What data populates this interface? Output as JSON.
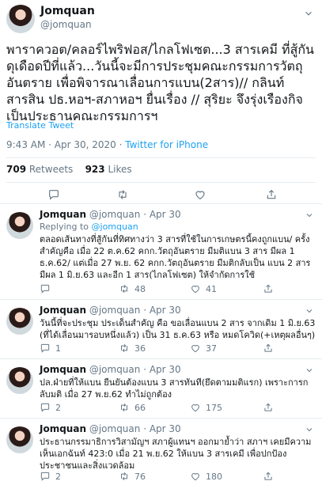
{
  "main_tweet": {
    "name": "Jomquan",
    "handle": "@jomquan",
    "text": "พาราควอต/คลอร์ไพริฟอส/ไกลโฟเซต...3 สารเคมี ที่สู้กันดุเดือดปีที่แล้ว...วันนี้จะมีการประชุมคณะกรรมการวัตถุอันตราย เพื่อพิจารณาเลื่อนการแบน(2สาร)// กลินท์ สารสิน ปธ.หอฯ-สภาหอฯ ยื่นเรื่อง // สุริยะ จึงรุ่งเรืองกิจ เป็นประธานคณะกรรมการฯ",
    "translate": "Translate Tweet",
    "time": "9:43 AM · Apr 30, 2020 · ",
    "source": "Twitter for iPhone",
    "retweets_count": "709",
    "retweets_label": " Retweets",
    "likes_count": "923",
    "likes_label": " Likes"
  },
  "replies": [
    {
      "name": "Jomquan",
      "handle": "@jomquan",
      "date": "· Apr 30",
      "replying_prefix": "Replying to ",
      "replying_handle": "@jomquan",
      "text": "ตลอดเส้นทางที่สู้กันที่ทิศทางว่า 3 สารที่ใช้ในการเกษตรนี้คงถูกแบน/ ครั้งสำคัญคือ เมื่อ 22 ต.ค.62 คกก.วัตถุอันตราย มีมติแบน 3 สาร มีผล 1 ธ.ค.62/ แต่เมื่อ 27 พ.ย. 62 คกก.วัตถุอันตราย มีมติกลับเป็น แบน 2 สาร มีผล 1 มิ.ย.63 และอีก 1 สาร(ไกลโฟเซต) ให้จำกัดการใช้",
      "replies": "",
      "retweets": "48",
      "likes": "41"
    },
    {
      "name": "Jomquan",
      "handle": "@jomquan",
      "date": "· Apr 30",
      "text": "วันนี้ที่จะประชุม ประเด็นสำคัญ คือ ขอเลื่อนแบน 2 สาร จากเดิม 1 มิ.ย.63 (ที่ได้เลื่อนมารอบหนึ่งแล้ว) เป็น 31 ธ.ค.63 หรือ หมดโควิด(+เหตุผลอื่นๆ)",
      "replies": "1",
      "retweets": "36",
      "likes": "37"
    },
    {
      "name": "Jomquan",
      "handle": "@jomquan",
      "date": "· Apr 30",
      "text": "ปล.ฝ่ายที่ให้แบน ยืนยันต้องแบน 3 สารทันที(ยึดตามมติแรก) เพราะการกลับมติ เมื่อ 27 พ.ย.62 ทำไม่ถูกต้อง",
      "replies": "2",
      "retweets": "66",
      "likes": "175"
    },
    {
      "name": "Jomquan",
      "handle": "@jomquan",
      "date": "· Apr 30",
      "text": "ประธานกรรมาธิการวิสามัญฯ สภาผู้แทนฯ ออกมาย้ำว่า สภาฯ เคยมีความเห็นเอกฉันท์ 423:0 เมื่อ 21 พ.ย.62 ให้แบน 3 สารเคมี เพื่อปกป้องประชาชนและสิ่งแวดล้อม",
      "replies": "2",
      "retweets": "76",
      "likes": "180"
    }
  ],
  "icons": {
    "reply": "reply-icon",
    "retweet": "retweet-icon",
    "like": "heart-icon",
    "share": "share-icon",
    "more": "chevron-down-icon"
  },
  "colors": {
    "link": "#1da1f2",
    "secondary_text": "#657786",
    "divider": "#e6ecf0"
  }
}
